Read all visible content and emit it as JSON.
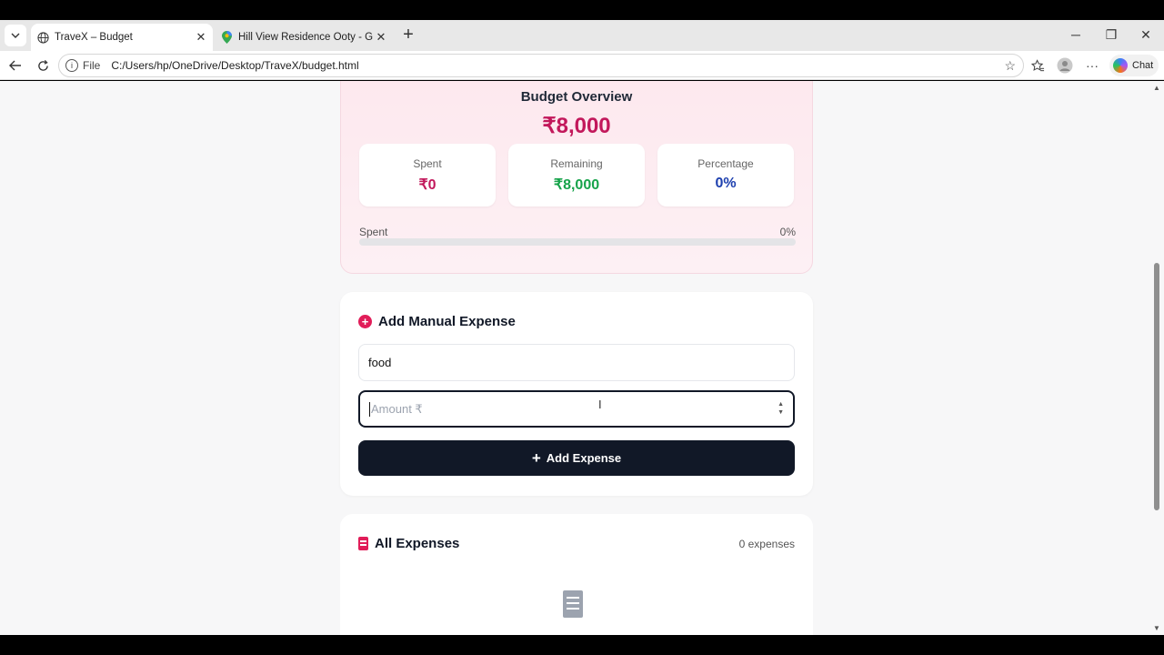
{
  "browser": {
    "tabs": [
      {
        "title": "TraveX – Budget",
        "active": true,
        "icon": "globe-icon"
      },
      {
        "title": "Hill View Residence Ooty - Google",
        "active": false,
        "icon": "maps-pin-icon"
      }
    ],
    "address": {
      "scheme_label": "File",
      "url": "C:/Users/hp/OneDrive/Desktop/TraveX/budget.html"
    },
    "chat_label": "Chat"
  },
  "overview": {
    "title": "Budget Overview",
    "total": "₹8,000",
    "stats": [
      {
        "label": "Spent",
        "value": "₹0",
        "color": "#c2185b"
      },
      {
        "label": "Remaining",
        "value": "₹8,000",
        "color": "#16a34a"
      },
      {
        "label": "Percentage",
        "value": "0%",
        "color": "#1e40af"
      }
    ],
    "progress_label": "Spent",
    "progress_text": "0%",
    "progress_value": 0
  },
  "add_expense": {
    "title": "Add Manual Expense",
    "name_value": "food",
    "amount_placeholder": "Amount ₹",
    "button_label": "Add Expense"
  },
  "expenses": {
    "title": "All Expenses",
    "count_label": "0 expenses"
  }
}
